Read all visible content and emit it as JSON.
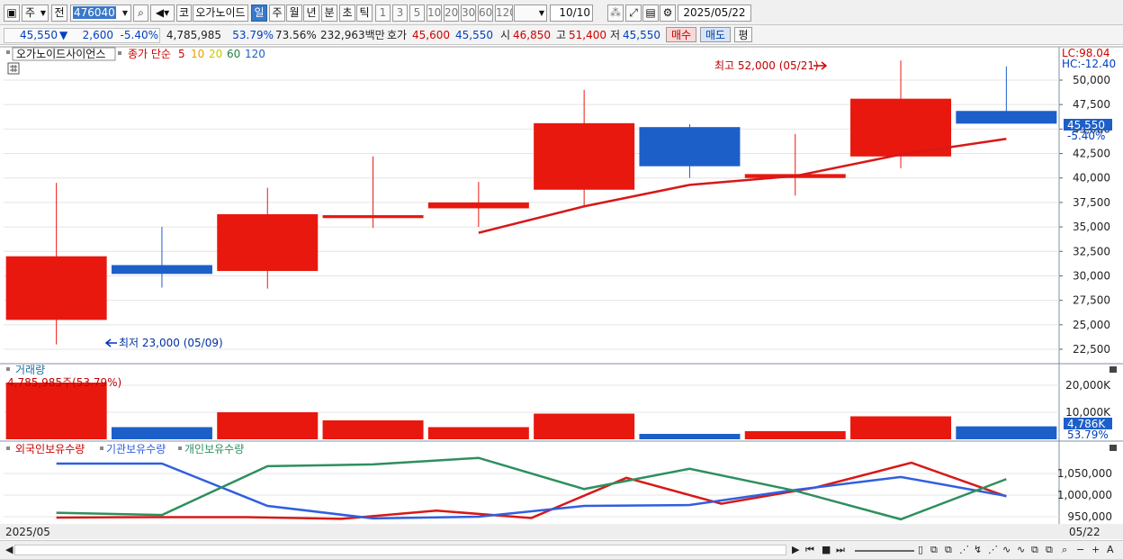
{
  "toolbar": {
    "period_select": "주",
    "prev_label": "전",
    "stock_code": "476040",
    "market_label": "코",
    "stock_name": "오가노이드",
    "tabs": [
      "일",
      "주",
      "월",
      "년",
      "분",
      "초",
      "틱"
    ],
    "active_tab": "일",
    "intervals": [
      "1",
      "3",
      "5",
      "10",
      "20",
      "30",
      "60",
      "120"
    ],
    "count": "10/10",
    "date": "2025/05/22"
  },
  "quote": {
    "price": "45,550",
    "change": "2,600",
    "change_rate": "-5.40%",
    "volume": "4,785,985",
    "volume_ratio": "53.79%",
    "turnover_rate": "73.56%",
    "amount": "232,963백만",
    "ask_label": "호가",
    "ask": "45,600",
    "bid": "45,550",
    "open_label": "시",
    "open": "46,850",
    "high_label": "고",
    "high": "51,400",
    "low_label": "저",
    "low": "45,550",
    "buy_label": "매수",
    "sell_label": "매도",
    "eval_label": "평"
  },
  "main_pane": {
    "name_box": "오가노이드사이언스",
    "ma_legend": {
      "label": "종가 단순",
      "periods": [
        "5",
        "10",
        "20",
        "60",
        "120"
      ],
      "colors": [
        "#d00000",
        "#e8a000",
        "#c8c800",
        "#208040",
        "#2060c0"
      ]
    },
    "lc": "LC:98.04",
    "hc": "HC:-12.40",
    "high_annotation": "최고 52,000 (05/21)",
    "low_annotation": "최저 23,000 (05/09)",
    "price_tag": "45,550",
    "pct_tag": "-5.40%"
  },
  "volume_pane": {
    "title": "거래량",
    "top_label": "4,785,985주(53.79%)",
    "tag_value": "4,786K",
    "tag_pct": "53.79%"
  },
  "holding_pane": {
    "legend": [
      "외국인보유수량",
      "기관보유수량",
      "개인보유수량"
    ]
  },
  "footer": {
    "left_date": "2025/05",
    "right_date": "05/22"
  },
  "colors": {
    "up": "#e8180e",
    "down": "#1d5fc9",
    "foreign": "#d81818",
    "inst": "#2f5fe0",
    "indiv": "#2e8f5e"
  },
  "chart_data": [
    {
      "type": "candlestick",
      "title": "오가노이드사이언스",
      "ylim": [
        21250,
        53300
      ],
      "yticks": [
        22500,
        25000,
        27500,
        30000,
        32500,
        35000,
        37500,
        40000,
        42500,
        45000,
        47500,
        50000
      ],
      "candles": [
        {
          "open": 25500,
          "close": 32000,
          "high": 39500,
          "low": 23000,
          "dir": "up"
        },
        {
          "open": 31100,
          "close": 30200,
          "high": 35000,
          "low": 28800,
          "dir": "down"
        },
        {
          "open": 30500,
          "close": 36300,
          "high": 39000,
          "low": 28700,
          "dir": "up"
        },
        {
          "open": 35900,
          "close": 36200,
          "high": 42200,
          "low": 34900,
          "dir": "up"
        },
        {
          "open": 36900,
          "close": 37500,
          "high": 39600,
          "low": 35000,
          "dir": "up"
        },
        {
          "open": 38800,
          "close": 45600,
          "high": 49000,
          "low": 37200,
          "dir": "up"
        },
        {
          "open": 45200,
          "close": 41200,
          "high": 45500,
          "low": 40000,
          "dir": "down"
        },
        {
          "open": 40000,
          "close": 40400,
          "high": 44500,
          "low": 38200,
          "dir": "up"
        },
        {
          "open": 42200,
          "close": 48100,
          "high": 52000,
          "low": 41000,
          "dir": "up"
        },
        {
          "open": 46850,
          "close": 45550,
          "high": 51400,
          "low": 45550,
          "dir": "down"
        }
      ],
      "ma5": [
        null,
        null,
        null,
        null,
        34400,
        37100,
        39300,
        40200,
        42400,
        44000
      ]
    },
    {
      "type": "bar",
      "title": "거래량",
      "ylim": [
        0,
        22000
      ],
      "yticks": [
        10000,
        20000
      ],
      "tick_labels": [
        "10,000K",
        "20,000K"
      ],
      "values": [
        21000,
        4500,
        10000,
        7000,
        4500,
        9500,
        2000,
        3000,
        8500,
        4786
      ],
      "dirs": [
        "up",
        "down",
        "up",
        "up",
        "up",
        "up",
        "down",
        "up",
        "up",
        "down"
      ]
    },
    {
      "type": "line",
      "ylim": [
        940000,
        1065000
      ],
      "yticks": [
        950000,
        1000000,
        1050000
      ],
      "tick_labels": [
        "950,000",
        "1,000,000",
        "1,050,000"
      ],
      "series": [
        {
          "name": "외국인보유수량",
          "values": [
            948000,
            949000,
            949000,
            945000,
            964000,
            947000,
            1040000,
            980000,
            1018000,
            1075000,
            997000
          ]
        },
        {
          "name": "기관보유수량",
          "values": [
            1073000,
            1073000,
            975000,
            946000,
            950000,
            975000,
            977000,
            1012000,
            1042000,
            998000
          ]
        },
        {
          "name": "개인보유수량",
          "values": [
            959000,
            954000,
            1067000,
            1071000,
            1086000,
            1014000,
            1061000,
            1010000,
            944000,
            1037000
          ]
        }
      ]
    }
  ]
}
